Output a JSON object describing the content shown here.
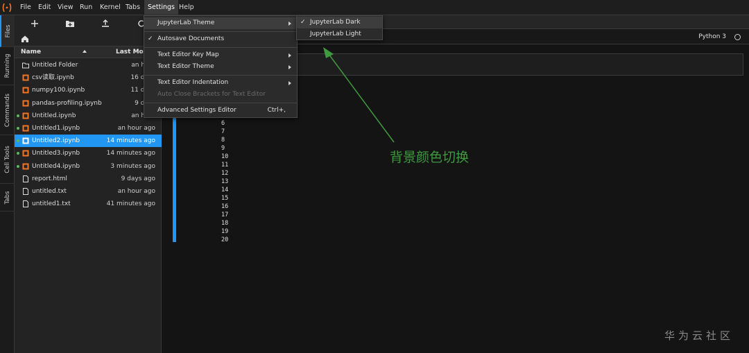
{
  "menubar": {
    "items": [
      "File",
      "Edit",
      "View",
      "Run",
      "Kernel",
      "Tabs",
      "Settings",
      "Help"
    ],
    "active": "Settings"
  },
  "left_tabs": [
    "Files",
    "Running",
    "Commands",
    "Cell Tools",
    "Tabs"
  ],
  "file_browser": {
    "columns": {
      "name": "Name",
      "modified": "Last Mod"
    },
    "files": [
      {
        "name": "Untitled Folder",
        "modified": "an hour",
        "type": "folder-icon",
        "running": false
      },
      {
        "name": "csv读取.ipynb",
        "modified": "16 days",
        "type": "notebook-icon",
        "running": false
      },
      {
        "name": "numpy100.ipynb",
        "modified": "11 days",
        "type": "notebook-icon",
        "running": false
      },
      {
        "name": "pandas-profiling.ipynb",
        "modified": "9 days",
        "type": "notebook-icon",
        "running": false
      },
      {
        "name": "Untitled.ipynb",
        "modified": "an hour",
        "type": "notebook-icon",
        "running": true
      },
      {
        "name": "Untitled1.ipynb",
        "modified": "an hour ago",
        "type": "notebook-icon",
        "running": true
      },
      {
        "name": "Untitled2.ipynb",
        "modified": "14 minutes ago",
        "type": "notebook-icon",
        "running": true,
        "selected": true
      },
      {
        "name": "Untitled3.ipynb",
        "modified": "14 minutes ago",
        "type": "notebook-icon",
        "running": true
      },
      {
        "name": "Untitled4.ipynb",
        "modified": "3 minutes ago",
        "type": "notebook-icon",
        "running": true
      },
      {
        "name": "report.html",
        "modified": "9 days ago",
        "type": "file-icon",
        "running": false
      },
      {
        "name": "untitled.txt",
        "modified": "an hour ago",
        "type": "file-icon",
        "running": false
      },
      {
        "name": "untitled1.txt",
        "modified": "41 minutes ago",
        "type": "file-icon",
        "running": false
      }
    ]
  },
  "notebook": {
    "kernel": "Python 3",
    "output_lines": [
      "6",
      "7",
      "8",
      "9",
      "10",
      "11",
      "12",
      "13",
      "14",
      "15",
      "16",
      "17",
      "18",
      "19",
      "20"
    ]
  },
  "settings_menu": {
    "theme": "JupyterLab Theme",
    "autosave": "Autosave Documents",
    "keymap": "Text Editor Key Map",
    "editor_theme": "Text Editor Theme",
    "indentation": "Text Editor Indentation",
    "auto_close": "Auto Close Brackets for Text Editor",
    "advanced": "Advanced Settings Editor",
    "advanced_shortcut": "Ctrl+,"
  },
  "theme_submenu": {
    "dark": "JupyterLab Dark",
    "light": "JupyterLab Light"
  },
  "annotation": "背景颜色切换",
  "watermark": "华为云社区",
  "colors": {
    "accent": "#2196f3",
    "annotation": "#3f9a3f",
    "notebook_icon": "#f37626",
    "running_dot": "#5fb85f"
  }
}
